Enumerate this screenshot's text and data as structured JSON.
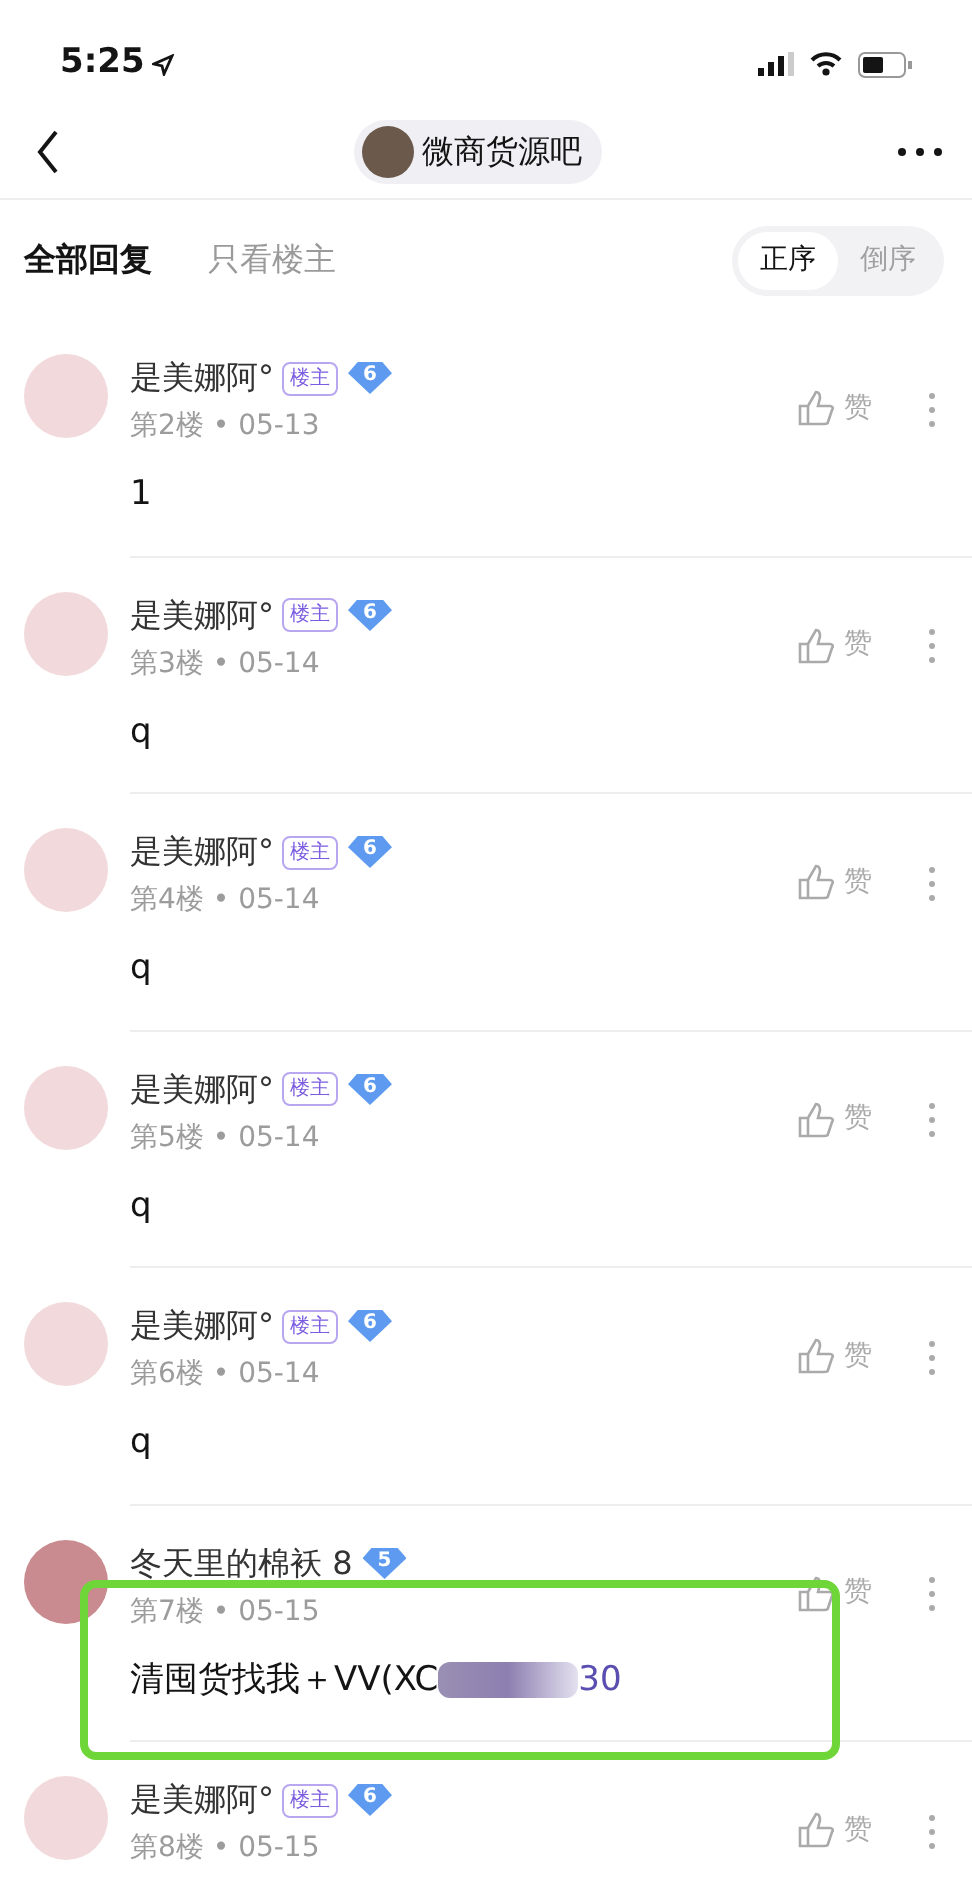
{
  "status_bar": {
    "time": "5:25"
  },
  "nav": {
    "forum": "微商货源吧"
  },
  "filter_tabs": [
    {
      "label": "全部回复",
      "selected": true
    },
    {
      "label": "只看楼主",
      "selected": false
    }
  ],
  "sort_toggle": [
    {
      "label": "正序",
      "selected": true
    },
    {
      "label": "倒序",
      "selected": false
    }
  ],
  "posts": [
    {
      "author": "是美娜阿°",
      "op_tag": "楼主",
      "level_badge": "6",
      "meta": "第2楼 • 05-13",
      "content": "1",
      "like": "赞",
      "highlighted": false
    },
    {
      "author": "是美娜阿°",
      "op_tag": "楼主",
      "level_badge": "6",
      "meta": "第3楼 • 05-14",
      "content": "q",
      "like": "赞",
      "highlighted": false
    },
    {
      "author": "是美娜阿°",
      "op_tag": "楼主",
      "level_badge": "6",
      "meta": "第4楼 • 05-14",
      "content": "q",
      "like": "赞",
      "highlighted": false
    },
    {
      "author": "是美娜阿°",
      "op_tag": "楼主",
      "level_badge": "6",
      "meta": "第5楼 • 05-14",
      "content": "q",
      "like": "赞",
      "highlighted": false
    },
    {
      "author": "是美娜阿°",
      "op_tag": "楼主",
      "level_badge": "6",
      "meta": "第6楼 • 05-14",
      "content": "q",
      "like": "赞",
      "highlighted": false
    },
    {
      "author": "冬天里的棉袄 8",
      "level_badge": "5",
      "meta": "第7楼 • 05-15",
      "content": "清囤货找我＋VV(XC",
      "redacted": true,
      "content_tail": "30",
      "like": "赞",
      "highlighted": true
    },
    {
      "author": "是美娜阿°",
      "op_tag": "楼主",
      "level_badge": "6",
      "meta": "第8楼 • 05-15",
      "like": "赞",
      "highlighted": false
    }
  ]
}
